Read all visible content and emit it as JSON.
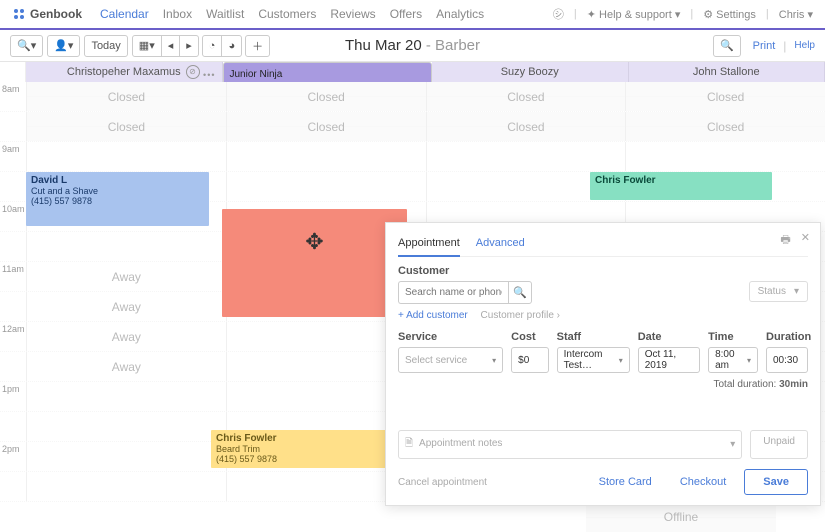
{
  "brand": "Genbook",
  "nav": [
    "Calendar",
    "Inbox",
    "Waitlist",
    "Customers",
    "Reviews",
    "Offers",
    "Analytics"
  ],
  "navright": {
    "help": "Help & support",
    "settings": "Settings",
    "user": "Chris"
  },
  "toolbar": {
    "today": "Today",
    "date": "Thu Mar 20",
    "sub": " - Barber",
    "print": "Print",
    "help": "Help"
  },
  "staff": [
    "Christopeher Maxamus",
    "Junior Ninja",
    "Suzy Boozy",
    "John Stallone"
  ],
  "hours": [
    "8am",
    "9am",
    "10am",
    "11am",
    "12am",
    "1pm",
    "2pm"
  ],
  "closed_label": "Closed",
  "away_label": "Away",
  "offline_label": "Offline",
  "events": {
    "david": {
      "name": "David L",
      "service": "Cut and a Shave",
      "phone": "(415) 557 9878"
    },
    "fowler1": {
      "name": "Chris Fowler"
    },
    "fowler2": {
      "name": "Chris Fowler",
      "service": "Beard Trim",
      "phone": "(415) 557 9878"
    }
  },
  "panel": {
    "tabs": {
      "appt": "Appointment",
      "adv": "Advanced"
    },
    "customer_label": "Customer",
    "search_placeholder": "Search name or phone #",
    "status": "Status",
    "add_customer": "+ Add customer",
    "profile": "Customer profile ›",
    "service_label": "Service",
    "service_ph": "Select service",
    "cost_label": "Cost",
    "cost_val": "$0",
    "staff_label": "Staff",
    "staff_val": "Intercom Test…",
    "date_label": "Date",
    "date_val": "Oct 11, 2019",
    "time_label": "Time",
    "time_val": "8:00 am",
    "dur_label": "Duration",
    "dur_val": "00:30",
    "total": "Total duration: ",
    "total_val": "30min",
    "notes_ph": "Appointment notes",
    "unpaid": "Unpaid",
    "cancel": "Cancel appointment",
    "store": "Store Card",
    "checkout": "Checkout",
    "save": "Save"
  }
}
